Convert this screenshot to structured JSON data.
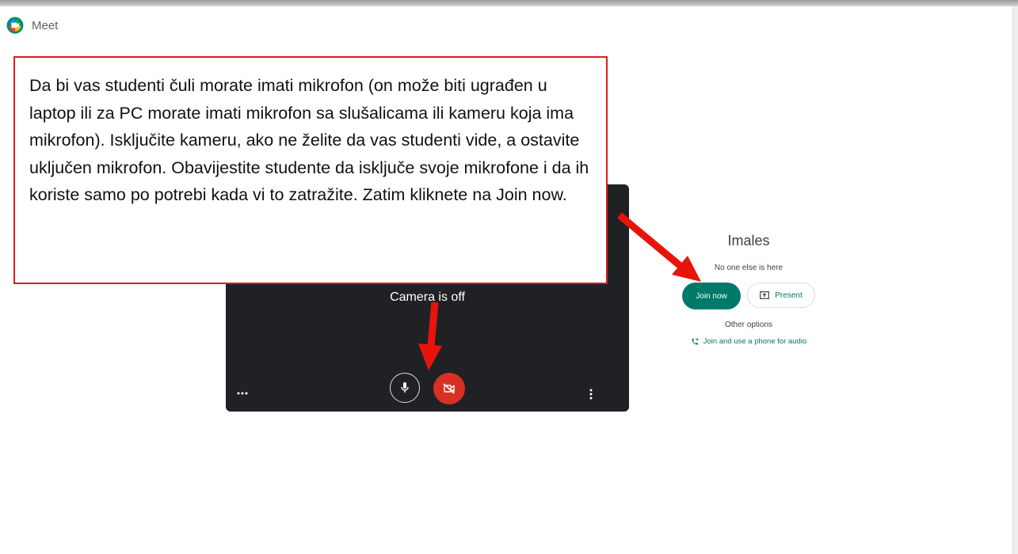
{
  "app": {
    "name": "Meet",
    "logo_icon": "google-meet-logo-icon"
  },
  "preview": {
    "camera_status": "Camera is off",
    "more_options_icon": "more-horiz-icon",
    "mic_icon": "microphone-icon",
    "camera_icon": "videocam-off-icon",
    "menu_icon": "more-vert-icon"
  },
  "join_panel": {
    "meeting_name": "Imales",
    "participants_note": "No one else is here",
    "join_button_label": "Join now",
    "present_button_label": "Present",
    "present_icon": "present-to-all-icon",
    "other_options_label": "Other options",
    "phone_audio_label": "Join and use a phone for audio",
    "phone_icon": "phone-forwarded-icon"
  },
  "annotation": {
    "text": "Da bi vas studenti čuli morate imati mikrofon (on može biti ugrađen u laptop ili za PC morate imati mikrofon sa slušalicama ili kameru koja ima mikrofon). Isključite kameru, ako ne želite da vas studenti vide, a ostavite uključen mikrofon. Obavijestite studente da isključe svoje mikrofone i da ih koriste samo po potrebi kada vi to zatražite. Zatim kliknete na Join now.",
    "border_color": "#e01b1b",
    "arrow_color": "#e8140c"
  },
  "colors": {
    "accent": "#00796b",
    "camera_off_button": "#d93025",
    "preview_background": "#202124"
  }
}
